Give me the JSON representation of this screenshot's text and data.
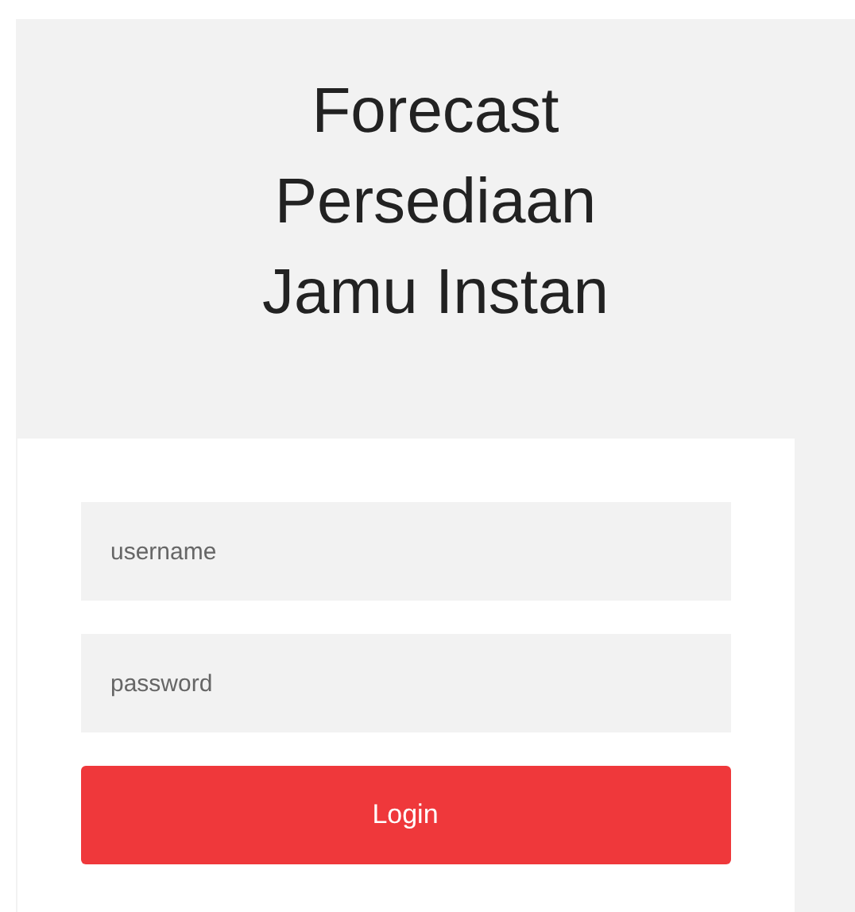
{
  "title": "Forecast Persediaan Jamu Instan",
  "form": {
    "fields": [
      {
        "placeholder": "username"
      },
      {
        "placeholder": "password"
      }
    ],
    "button": "Login"
  }
}
